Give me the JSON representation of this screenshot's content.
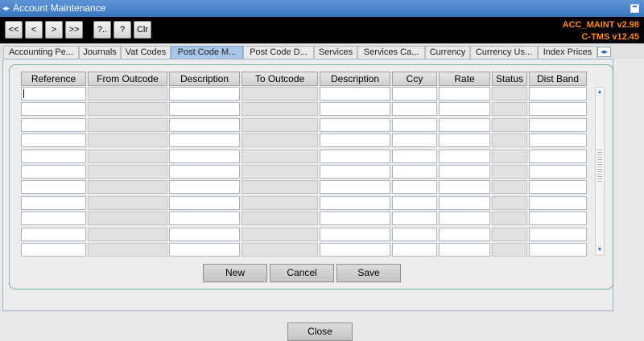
{
  "window": {
    "title": "Account Maintenance"
  },
  "toolbar": {
    "buttons": [
      "<<",
      "<",
      ">",
      ">>",
      "?..",
      "?",
      "Clr"
    ],
    "version_line1": "ACC_MAINT v2.98",
    "version_line2": "C-TMS v12.45"
  },
  "tabs": [
    {
      "label": "Accounting Pe..."
    },
    {
      "label": "Journals"
    },
    {
      "label": "Vat Codes"
    },
    {
      "label": "Post Code M...",
      "active": true
    },
    {
      "label": "Post Code D..."
    },
    {
      "label": "Services"
    },
    {
      "label": "Services Ca..."
    },
    {
      "label": "Currency"
    },
    {
      "label": "Currency Us..."
    },
    {
      "label": "Index Prices"
    }
  ],
  "table": {
    "columns": [
      "Reference",
      "From Outcode",
      "Description",
      "To Outcode",
      "Description",
      "Ccy",
      "Rate",
      "Status",
      "Dist Band"
    ],
    "readonly_columns": [
      1,
      3,
      7
    ],
    "row_count": 11,
    "rows": []
  },
  "actions": {
    "new_label": "New",
    "cancel_label": "Cancel",
    "save_label": "Save"
  },
  "footer": {
    "close_label": "Close"
  },
  "colors": {
    "titlebar": "#3a74c0",
    "version_text": "#ff8c1a",
    "active_tab": "#a7c6e8"
  }
}
